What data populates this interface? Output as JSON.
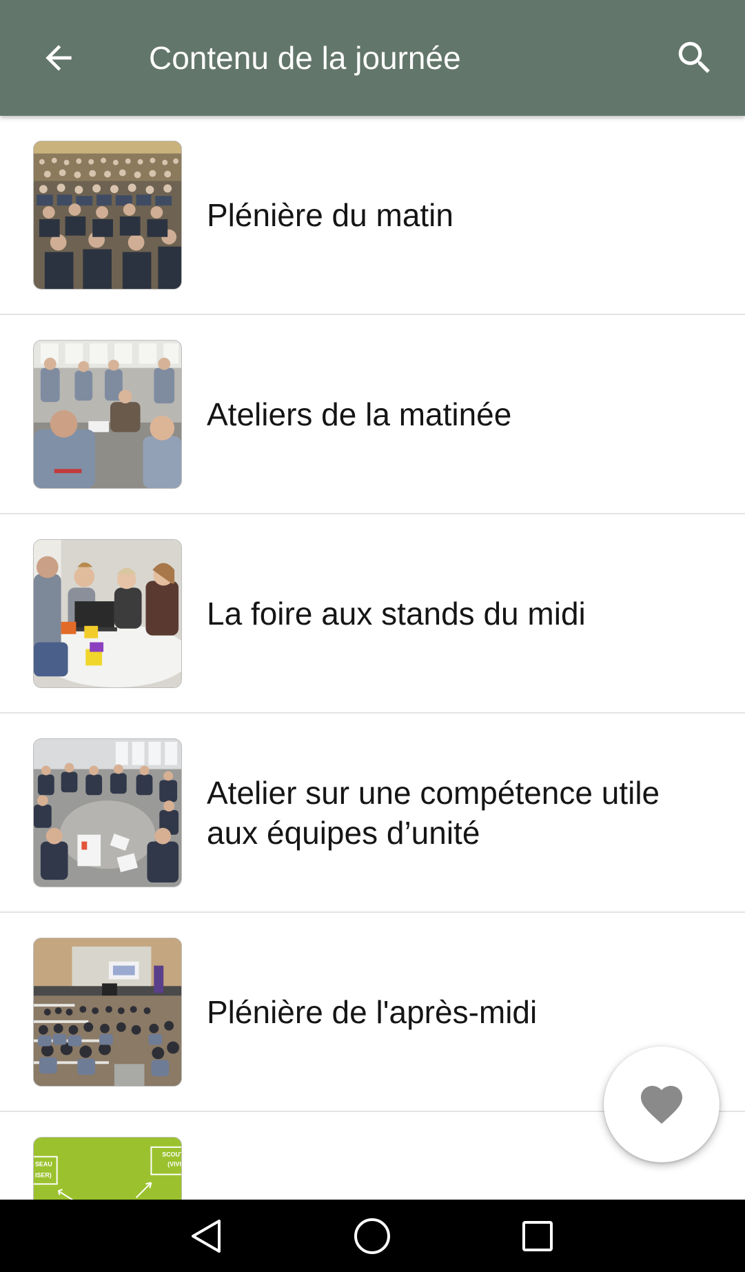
{
  "header": {
    "title": "Contenu de la journée",
    "background_color": "#63766b",
    "back_icon": "arrow-back-icon",
    "search_icon": "search-icon"
  },
  "items": [
    {
      "label": "Plénière du matin",
      "image": "photo-auditorium-audience"
    },
    {
      "label": "Ateliers de la matinée",
      "image": "photo-group-circle-workshop"
    },
    {
      "label": "La foire aux stands du midi",
      "image": "photo-table-laptop-stand"
    },
    {
      "label": "Atelier sur une compétence utile aux équipes d’unité",
      "image": "photo-group-circle-floor"
    },
    {
      "label": "Plénière de l'après-midi",
      "image": "photo-lecture-hall-screen"
    },
    {
      "label": "",
      "image": "photo-green-diagram-partial"
    }
  ],
  "fab": {
    "icon": "heart-icon",
    "color": "#8a8a8a"
  },
  "navbar": {
    "back_icon": "nav-back-triangle-icon",
    "home_icon": "nav-home-circle-icon",
    "recents_icon": "nav-recents-square-icon"
  }
}
